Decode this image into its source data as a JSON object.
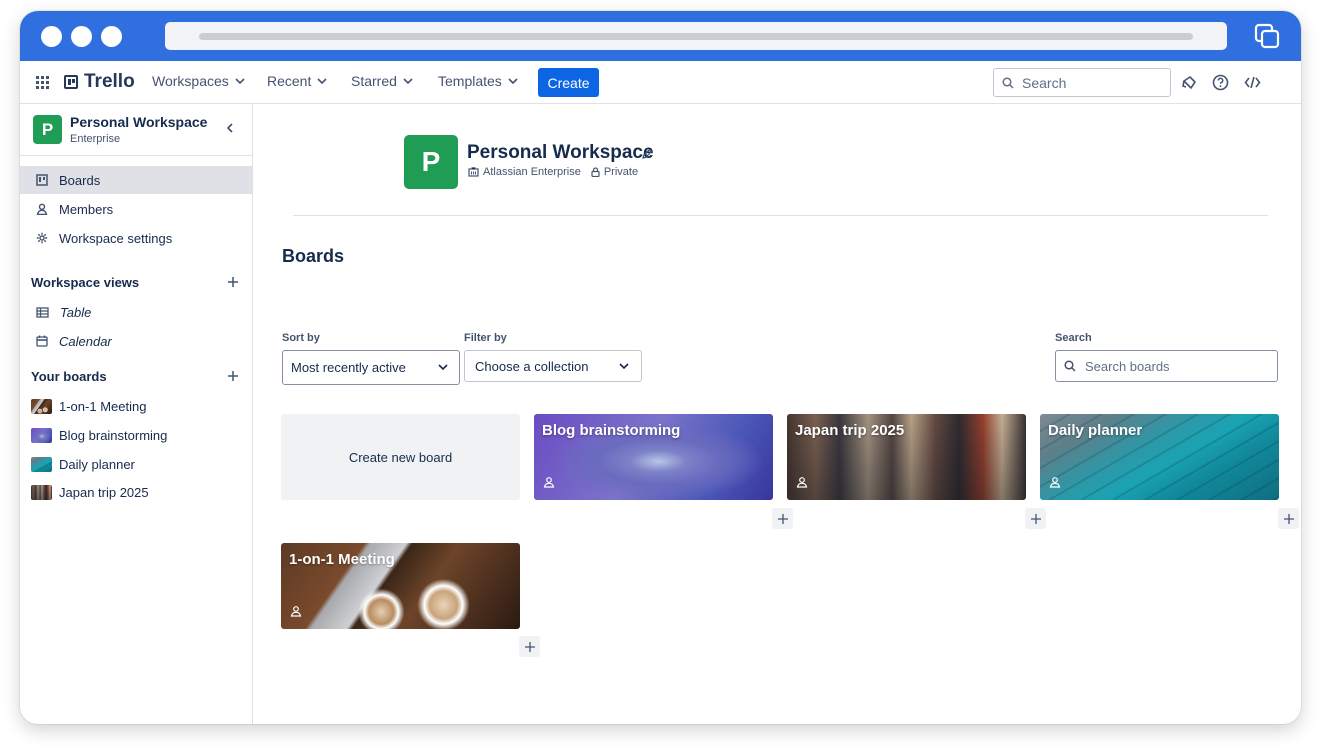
{
  "nav": {
    "logo": "Trello",
    "menus": [
      "Workspaces",
      "Recent",
      "Starred",
      "Templates"
    ],
    "create_label": "Create",
    "search_placeholder": "Search"
  },
  "sidebar": {
    "workspace_name": "Personal Workspace",
    "workspace_plan": "Enterprise",
    "items": [
      "Boards",
      "Members",
      "Workspace settings"
    ],
    "views_title": "Workspace views",
    "views": [
      "Table",
      "Calendar"
    ],
    "boards_title": "Your boards",
    "boards": [
      "1-on-1 Meeting",
      "Blog brainstorming",
      "Daily planner",
      "Japan trip 2025"
    ]
  },
  "main": {
    "avatar_letter": "P",
    "workspace_title": "Personal Workspace",
    "enterprise_label": "Atlassian Enterprise",
    "visibility_label": "Private",
    "boards_heading": "Boards",
    "sort_label": "Sort by",
    "sort_value": "Most recently active",
    "filter_label": "Filter by",
    "filter_value": "Choose a collection",
    "search_label": "Search",
    "search_placeholder": "Search boards",
    "create_board_label": "Create new board",
    "board_tiles": [
      "Blog brainstorming",
      "Japan trip 2025",
      "Daily planner",
      "1-on-1 Meeting"
    ]
  },
  "colors": {
    "chrome": "#2f6fe0",
    "create_button": "#0c66e4",
    "workspace_avatar": "#1f9d55",
    "active_item": "#dfe1e6"
  },
  "icons": [
    "apps-grid-icon",
    "trello-logo-icon",
    "chevron-down-icon",
    "search-icon",
    "megaphone-icon",
    "help-icon",
    "code-icon",
    "chevron-left-icon",
    "board-icon",
    "member-icon",
    "gear-icon",
    "plus-icon",
    "table-icon",
    "calendar-icon",
    "pencil-icon",
    "building-icon",
    "lock-icon",
    "workspace-icon",
    "tabs-icon"
  ]
}
